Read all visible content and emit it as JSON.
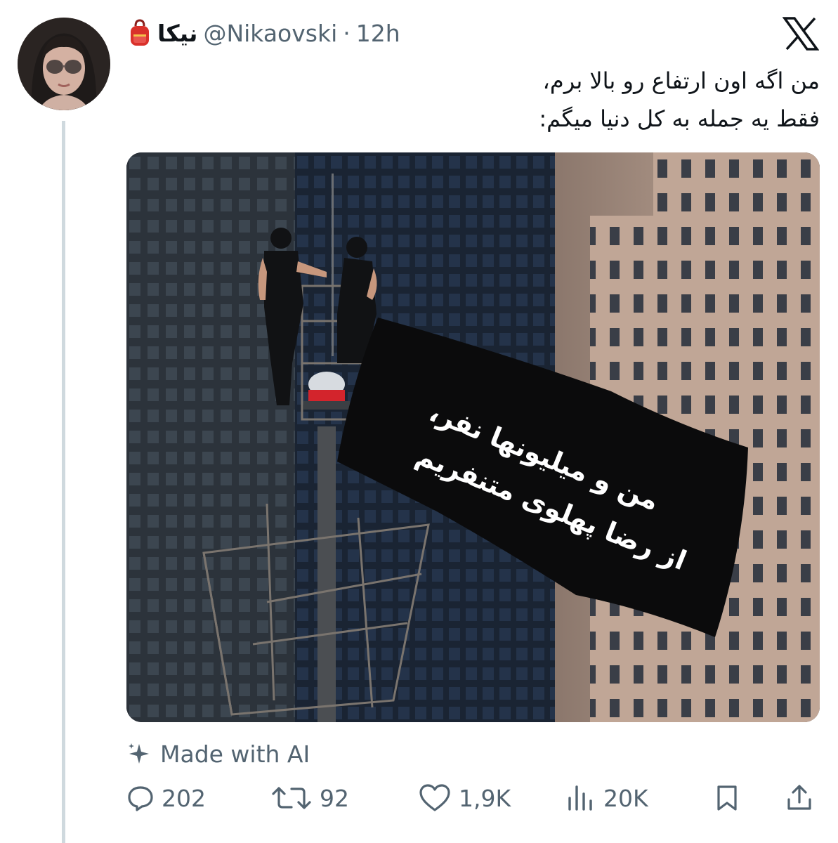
{
  "tweet": {
    "author": {
      "display_name": "نیکا",
      "display_emoji": "backpack-icon",
      "handle": "@Nikaovski",
      "separator": "·",
      "time": "12h"
    },
    "text_lines": [
      "من اگه اون ارتفاع رو بالا برم،",
      "فقط یه جمله به کل دنیا میگم:"
    ],
    "media": {
      "banner_lines": [
        "من و میلیونها نفر،",
        "از رضا پهلوی متنفریم"
      ]
    },
    "ai_label": "Made with AI",
    "actions": {
      "replies": "202",
      "reposts": "92",
      "likes": "1,9K",
      "views": "20K"
    }
  },
  "colors": {
    "text": "#0f1419",
    "secondary": "#536471",
    "thread_line": "#cfd9de"
  }
}
